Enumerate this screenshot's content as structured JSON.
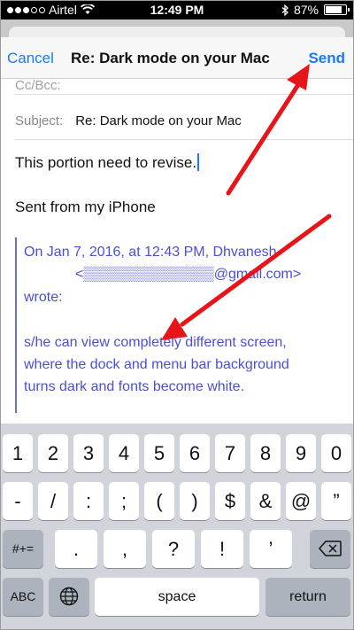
{
  "status_bar": {
    "carrier": "Airtel",
    "time": "12:49 PM",
    "battery_percent": "87%"
  },
  "nav": {
    "cancel_label": "Cancel",
    "title": "Re: Dark mode on your Mac",
    "send_label": "Send"
  },
  "compose": {
    "ccbcc_label": "Cc/Bcc:",
    "subject_label": "Subject:",
    "subject_value": "Re: Dark mode on your Mac",
    "body_line": "This portion need to revise.",
    "signature": "Sent from my iPhone",
    "quote": {
      "header_line1": "On Jan 7, 2016, at 12:43 PM, Dhvanesh",
      "header_email": "<▒▒▒▒▒▒▒▒▒▒▒▒▒@gmail.com>",
      "header_line3": "wrote:",
      "body_line1": "s/he can view completely different screen,",
      "body_line2": "where the dock and menu bar background",
      "body_line3": "turns dark and fonts become white."
    }
  },
  "keyboard": {
    "row1": [
      "1",
      "2",
      "3",
      "4",
      "5",
      "6",
      "7",
      "8",
      "9",
      "0"
    ],
    "row2": [
      "-",
      "/",
      ":",
      ";",
      "(",
      ")",
      "$",
      "&",
      "@",
      "”"
    ],
    "row3": {
      "mode": "#+=",
      "keys": [
        ".",
        ",",
        "?",
        "!",
        "’"
      ],
      "delete_icon": "backspace-icon"
    },
    "row4": {
      "abc": "ABC",
      "globe_icon": "globe-icon",
      "space": "space",
      "return": "return"
    }
  },
  "colors": {
    "accent": "#1a7cf4",
    "quote": "#4b4fd6",
    "annotation_arrow": "#e8141a"
  }
}
